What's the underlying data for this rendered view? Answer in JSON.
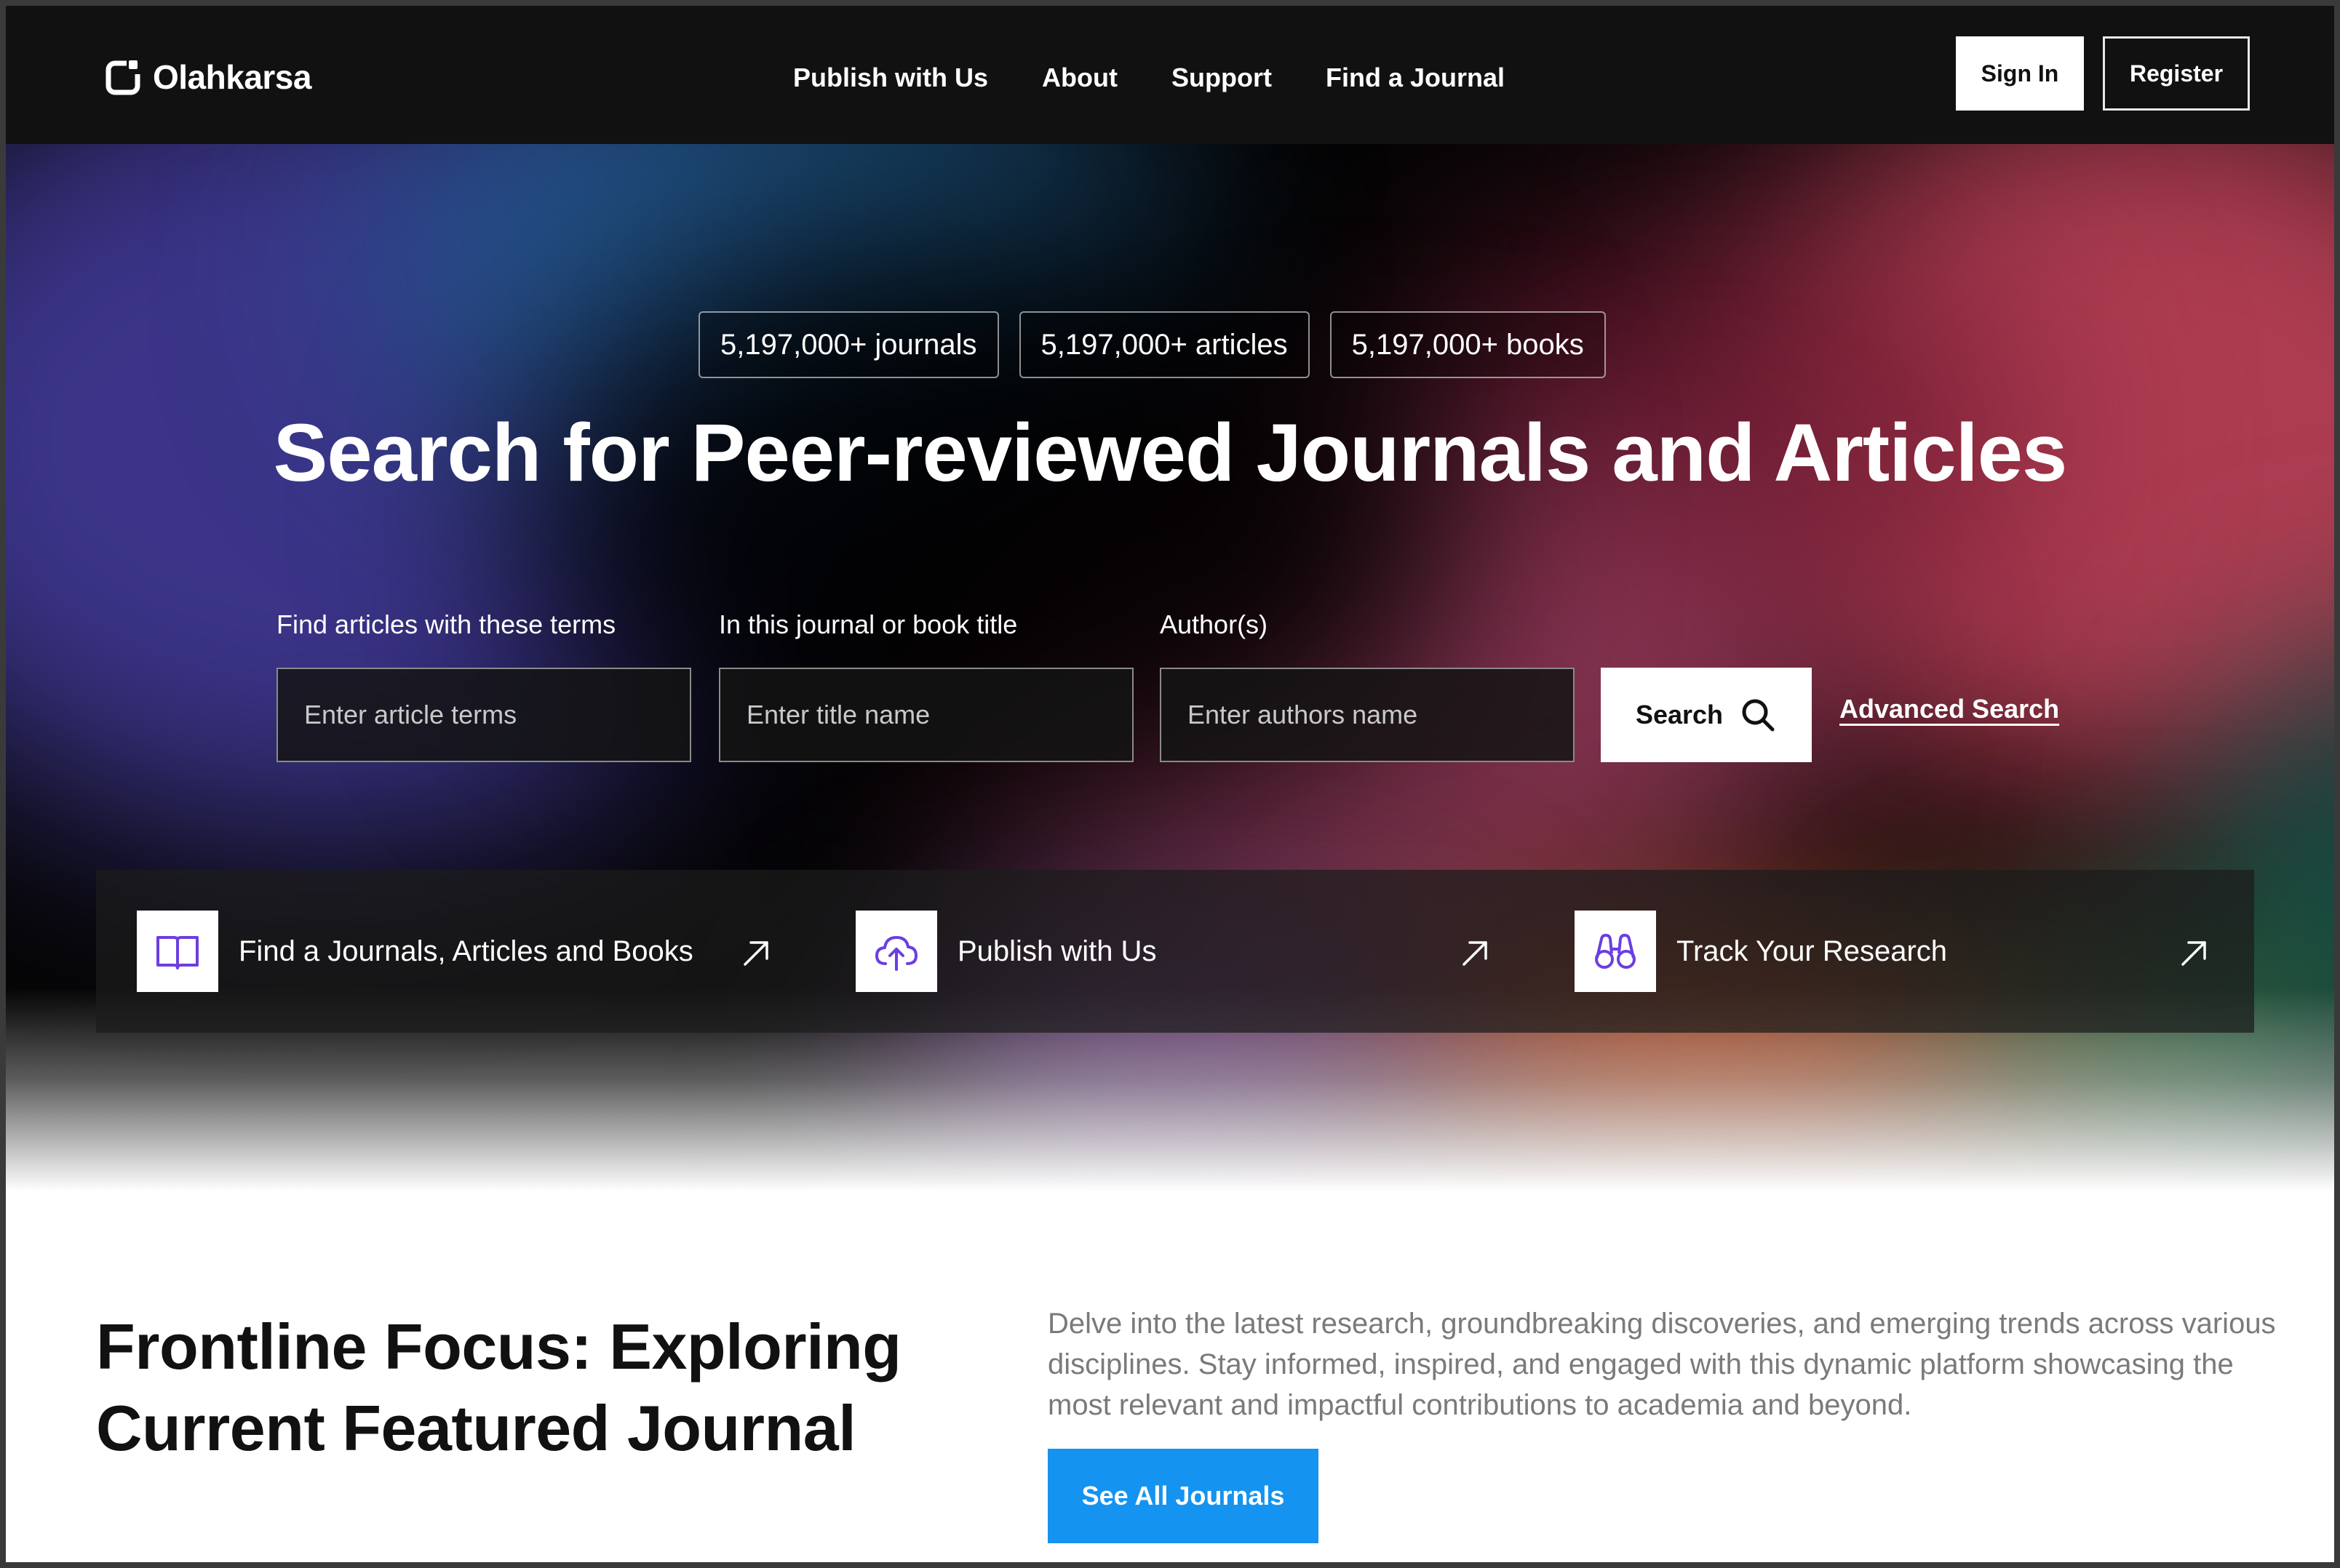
{
  "nav": {
    "brand": "Olahkarsa",
    "links": [
      "Publish with Us",
      "About",
      "Support",
      "Find a Journal"
    ],
    "sign_in": "Sign In",
    "register": "Register"
  },
  "hero": {
    "stats": [
      "5,197,000+ journals",
      "5,197,000+ articles",
      "5,197,000+ books"
    ],
    "title": "Search for Peer-reviewed Journals and Articles",
    "search": {
      "terms_label": "Find articles with these terms",
      "terms_placeholder": "Enter article terms",
      "title_label": "In this journal or book title",
      "title_placeholder": "Enter title name",
      "author_label": "Author(s)",
      "author_placeholder": "Enter authors name",
      "button": "Search",
      "advanced": "Advanced Search"
    },
    "cards": [
      {
        "label": "Find a Journals, Articles and Books",
        "icon": "book-open-icon"
      },
      {
        "label": "Publish with Us",
        "icon": "cloud-upload-icon"
      },
      {
        "label": "Track Your Research",
        "icon": "binoculars-icon"
      }
    ]
  },
  "featured": {
    "title": "Frontline Focus: Exploring Current Featured Journal",
    "description": "Delve into the latest research, groundbreaking discoveries, and emerging trends across various disciplines. Stay informed, inspired, and engaged with this dynamic platform showcasing the most relevant and impactful contributions to academia and beyond.",
    "button": "See All Journals"
  },
  "colors": {
    "nav_bg": "#111111",
    "accent_purple": "#6b3fe0",
    "button_blue": "#1593f0"
  }
}
